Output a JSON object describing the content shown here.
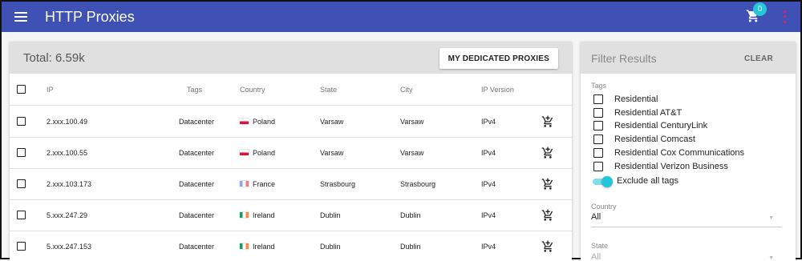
{
  "appbar": {
    "title": "HTTP Proxies",
    "cart_count": "0"
  },
  "main": {
    "total": "Total: 6.59k",
    "dedicated_button": "MY DEDICATED PROXIES",
    "columns": {
      "ip": "IP",
      "tags": "Tags",
      "country": "Country",
      "state": "State",
      "city": "City",
      "ip_version": "IP Version"
    },
    "rows": [
      {
        "ip": "2.xxx.100.49",
        "tags": "Datacenter",
        "country": "Poland",
        "flag": "pl",
        "state": "Varsaw",
        "city": "Varsaw",
        "ip_version": "IPv4"
      },
      {
        "ip": "2.xxx.100.55",
        "tags": "Datacenter",
        "country": "Poland",
        "flag": "pl",
        "state": "Varsaw",
        "city": "Varsaw",
        "ip_version": "IPv4"
      },
      {
        "ip": "2.xxx.103.173",
        "tags": "Datacenter",
        "country": "France",
        "flag": "fr",
        "state": "Strasbourg",
        "city": "Strasbourg",
        "ip_version": "IPv4"
      },
      {
        "ip": "5.xxx.247.29",
        "tags": "Datacenter",
        "country": "Ireland",
        "flag": "ie",
        "state": "Dublin",
        "city": "Dublin",
        "ip_version": "IPv4"
      },
      {
        "ip": "5.xxx.247.153",
        "tags": "Datacenter",
        "country": "Ireland",
        "flag": "ie",
        "state": "Dublin",
        "city": "Dublin",
        "ip_version": "IPv4"
      }
    ]
  },
  "filter": {
    "title": "Filter Results",
    "clear": "CLEAR",
    "tags_label": "Tags",
    "tags": [
      "Residential",
      "Residential AT&T",
      "Residential CenturyLink",
      "Residential Comcast",
      "Residential Cox Communications",
      "Residential Verizon Business"
    ],
    "exclude_label": "Exclude all tags",
    "exclude_on": true,
    "country_label": "Country",
    "country_value": "All",
    "state_label": "State",
    "state_value": "All"
  },
  "colors": {
    "appbar": "#3f51b5",
    "accent": "#26c6da",
    "kebab": "#e91e63"
  }
}
